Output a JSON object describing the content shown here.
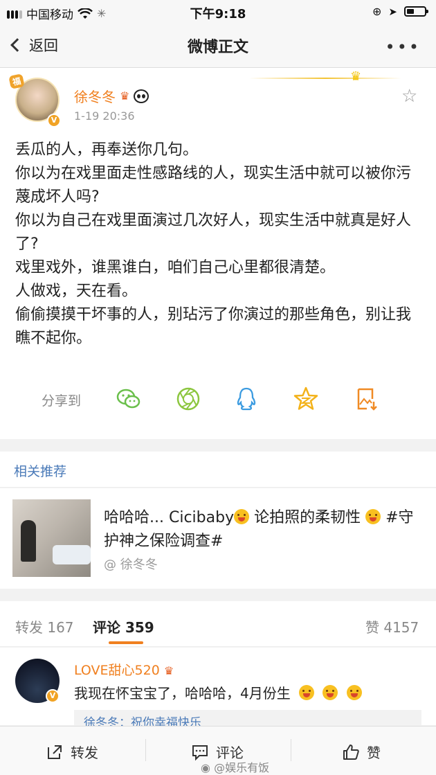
{
  "status_bar": {
    "carrier": "中国移动",
    "time": "下午9:18"
  },
  "nav": {
    "back_label": "返回",
    "title": "微博正文"
  },
  "post": {
    "author": "徐冬冬",
    "time": "1-19 20:36",
    "lines": [
      "丢瓜的人，再奉送你几句。",
      "你以为在戏里面走性感路线的人，现实生活中就可以被你污蔑成坏人吗?",
      "你以为自己在戏里面演过几次好人，现实生活中就真是好人了?",
      "戏里戏外，谁黑谁白，咱们自己心里都很清楚。",
      "人做戏，天在看。",
      "偷偷摸摸干坏事的人，别玷污了你演过的那些角色，别让我瞧不起你。"
    ],
    "share_label": "分享到"
  },
  "related": {
    "title": "相关推荐",
    "text_part1": "哈哈哈... Cicibaby",
    "text_part2": " 论拍照的柔韧性 ",
    "text_part3": " #守护神之保险调查#",
    "author": "@ 徐冬冬"
  },
  "tabs": {
    "repost": "转发 167",
    "comment": "评论 359",
    "like": "赞 4157"
  },
  "comment": {
    "name": "LOVE甜心520",
    "text": "我现在怀宝宝了，哈哈哈，4月份生",
    "reply_preview": "徐冬冬：祝你幸福快乐"
  },
  "toolbar": {
    "repost": "转发",
    "comment": "评论",
    "like": "赞",
    "watermark": "@娱乐有饭"
  },
  "colors": {
    "accent": "#f08020",
    "link": "#4a7ab8",
    "wechat": "#6abf4b",
    "moments": "#8cc63f",
    "qq": "#3b9be0",
    "qzone": "#f3b21a",
    "save": "#f08a24"
  }
}
